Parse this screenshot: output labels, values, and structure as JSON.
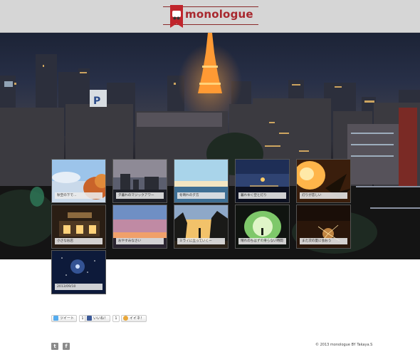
{
  "site": {
    "title": "monologue"
  },
  "gallery": {
    "items": [
      {
        "caption": "秋空の下で…",
        "palette": "autumn-sky"
      },
      {
        "caption": "夕暮れのマジックアワー",
        "palette": "dusk-city"
      },
      {
        "caption": "冬晴れの夕方",
        "palette": "winter-sea"
      },
      {
        "caption": "暮れゆく空と灯り",
        "palette": "blue-hour"
      },
      {
        "caption": "灯りが恋しい",
        "palette": "warm-light"
      },
      {
        "caption": "小さなお店",
        "palette": "shop-front"
      },
      {
        "caption": "おやすみなさい",
        "palette": "sunset-pink"
      },
      {
        "caption": "ミライに立っていくー",
        "palette": "silhouette"
      },
      {
        "caption": "晴れのちはずの帰らない時間",
        "palette": "tunnel"
      },
      {
        "caption": "また次の夏に会おう",
        "palette": "sparkler"
      },
      {
        "caption": "2013/09/10",
        "palette": "night-sky"
      }
    ]
  },
  "share": {
    "tweet": {
      "label": "ツイート",
      "count": "1"
    },
    "like": {
      "label": "いいね！",
      "count": "1"
    },
    "iine": {
      "label": "イイネ！"
    }
  },
  "footer": {
    "copyright": "© 2013 monologue BY Takaya.S",
    "twitter_icon_label": "t",
    "facebook_icon_label": "f"
  }
}
